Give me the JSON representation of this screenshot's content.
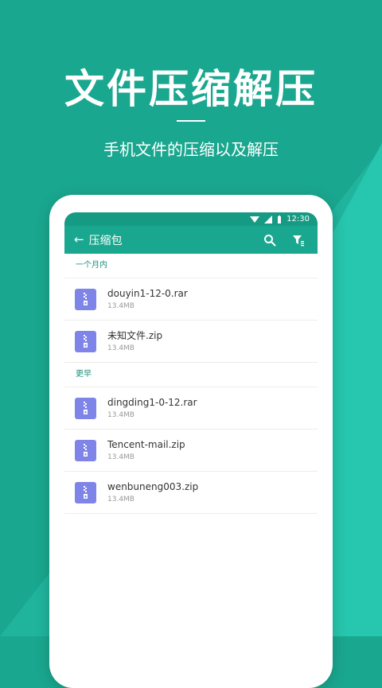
{
  "hero": {
    "title": "文件压缩解压",
    "subtitle": "手机文件的压缩以及解压"
  },
  "status_bar": {
    "time": "12:30"
  },
  "app_bar": {
    "back_icon": "arrow-left-icon",
    "title": "压缩包",
    "search_icon": "search-icon",
    "filter_icon": "filter-icon"
  },
  "sections": [
    {
      "label": "一个月内",
      "files": [
        {
          "name": "douyin1-12-0.rar",
          "size": "13.4MB"
        },
        {
          "name": "未知文件.zip",
          "size": "13.4MB"
        }
      ]
    },
    {
      "label": "更早",
      "files": [
        {
          "name": "dingding1-0-12.rar",
          "size": "13.4MB"
        },
        {
          "name": "Tencent-mail.zip",
          "size": "13.4MB"
        },
        {
          "name": "wenbuneng003.zip",
          "size": "13.4MB"
        }
      ]
    }
  ],
  "colors": {
    "background": "#1aa78f",
    "accent_light": "#2ecdb7",
    "file_icon": "#7f85e8"
  }
}
